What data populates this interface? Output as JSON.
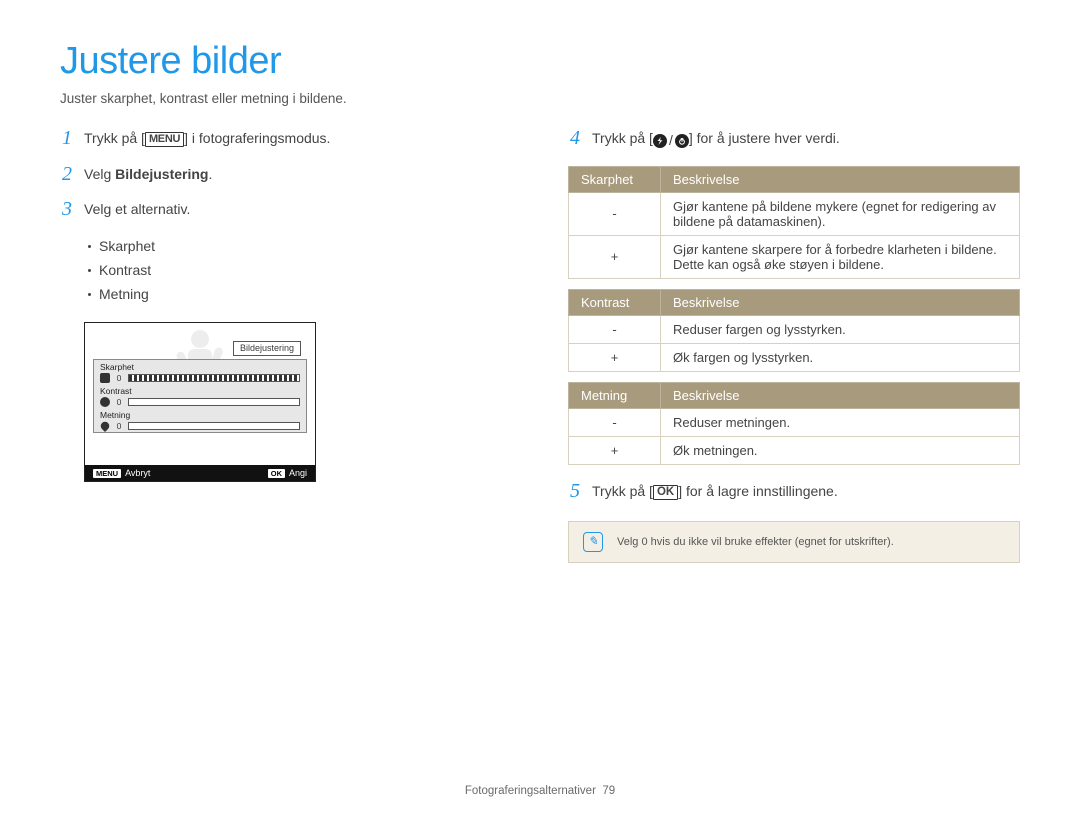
{
  "title": "Justere bilder",
  "subtitle": "Juster skarphet, kontrast eller metning i bildene.",
  "left": {
    "step1": {
      "num": "1",
      "pre": "Trykk på [",
      "badge": "MENU",
      "post": "] i fotograferingsmodus."
    },
    "step2": {
      "num": "2",
      "pre": "Velg ",
      "bold": "Bildejustering",
      "post": "."
    },
    "step3": {
      "num": "3",
      "text": "Velg et alternativ."
    },
    "bullets": [
      "Skarphet",
      "Kontrast",
      "Metning"
    ],
    "screen": {
      "panel_label": "Bildejustering",
      "rows": [
        {
          "label": "Skarphet",
          "value": "0"
        },
        {
          "label": "Kontrast",
          "value": "0"
        },
        {
          "label": "Metning",
          "value": "0"
        }
      ],
      "footer_left_badge": "MENU",
      "footer_left_text": "Avbryt",
      "footer_right_badge": "OK",
      "footer_right_text": "Angi"
    }
  },
  "right": {
    "step4": {
      "num": "4",
      "pre": "Trykk på [",
      "post": "] for å justere hver verdi."
    },
    "tables": [
      {
        "head": [
          "Skarphet",
          "Beskrivelse"
        ],
        "rows": [
          {
            "sym": "-",
            "desc": "Gjør kantene på bildene mykere (egnet for redigering av bildene på datamaskinen)."
          },
          {
            "sym": "+",
            "desc": "Gjør kantene skarpere for å forbedre klarheten i bildene. Dette kan også øke støyen i bildene."
          }
        ]
      },
      {
        "head": [
          "Kontrast",
          "Beskrivelse"
        ],
        "rows": [
          {
            "sym": "-",
            "desc": "Reduser fargen og lysstyrken."
          },
          {
            "sym": "+",
            "desc": "Øk fargen og lysstyrken."
          }
        ]
      },
      {
        "head": [
          "Metning",
          "Beskrivelse"
        ],
        "rows": [
          {
            "sym": "-",
            "desc": "Reduser metningen."
          },
          {
            "sym": "+",
            "desc": "Øk metningen."
          }
        ]
      }
    ],
    "step5": {
      "num": "5",
      "pre": "Trykk på [",
      "badge": "OK",
      "post": "] for å lagre innstillingene."
    },
    "note": "Velg 0 hvis du ikke vil bruke effekter (egnet for utskrifter)."
  },
  "footer": {
    "section": "Fotograferingsalternativer",
    "page": "79"
  }
}
